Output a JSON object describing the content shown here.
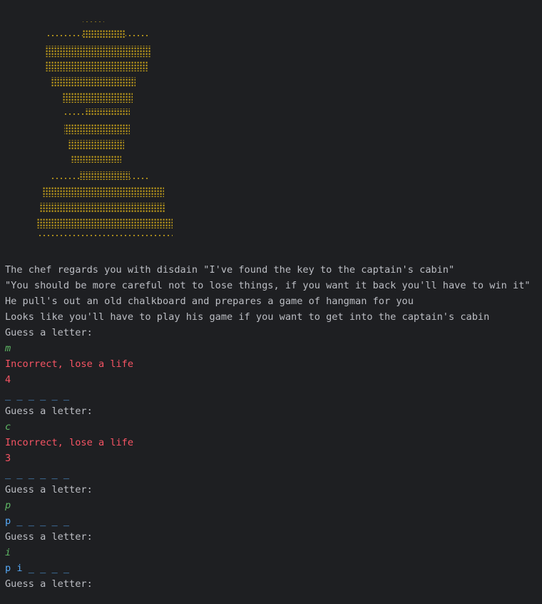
{
  "colors": {
    "background": "#1e1f22",
    "text": "#bcbec4",
    "user_input": "#5fb865",
    "error": "#f75464",
    "word": "#56a8f5",
    "art": "#c8a21a"
  },
  "art": {
    "icon": "chef-hat-ascii-art",
    "color": "#c8a21a"
  },
  "console": {
    "lines": [
      {
        "text": "The chef regards you with disdain \"I've found the key to the captain's cabin\"",
        "kind": "text"
      },
      {
        "text": "\"You should be more careful not to lose things, if you want it back you'll have to win it\"",
        "kind": "text"
      },
      {
        "text": "He pull's out an old chalkboard and prepares a game of hangman for you",
        "kind": "text"
      },
      {
        "text": "Looks like you'll have to play his game if you want to get into the captain's cabin",
        "kind": "text"
      },
      {
        "text": "Guess a letter:",
        "kind": "text"
      },
      {
        "text": "m",
        "kind": "input"
      },
      {
        "text": "Incorrect, lose a life",
        "kind": "error"
      },
      {
        "text": "4",
        "kind": "error"
      },
      {
        "text": "_ _ _ _ _ _",
        "kind": "word"
      },
      {
        "text": "Guess a letter:",
        "kind": "text"
      },
      {
        "text": "c",
        "kind": "input"
      },
      {
        "text": "Incorrect, lose a life",
        "kind": "error"
      },
      {
        "text": "3",
        "kind": "error"
      },
      {
        "text": "_ _ _ _ _ _",
        "kind": "word"
      },
      {
        "text": "Guess a letter:",
        "kind": "text"
      },
      {
        "text": "p",
        "kind": "input"
      },
      {
        "text": "p _ _ _ _ _",
        "kind": "word"
      },
      {
        "text": "Guess a letter:",
        "kind": "text"
      },
      {
        "text": "i",
        "kind": "input"
      },
      {
        "text": "p i _ _ _ _",
        "kind": "word"
      },
      {
        "text": "Guess a letter:",
        "kind": "text"
      }
    ]
  }
}
